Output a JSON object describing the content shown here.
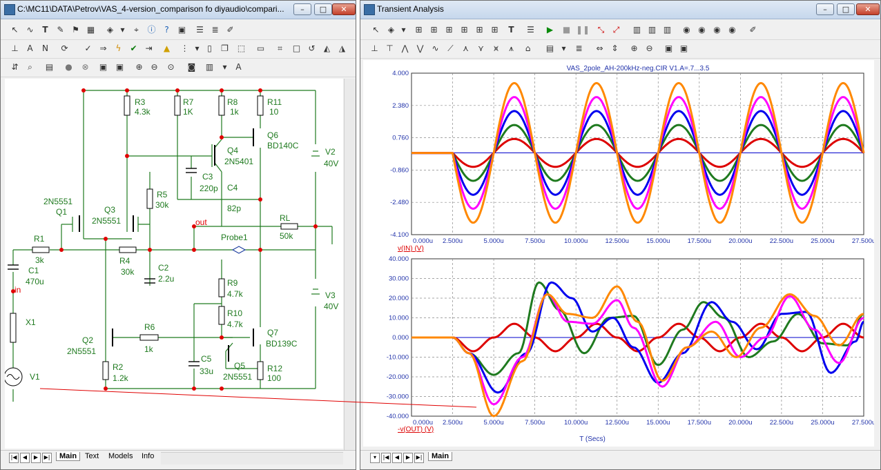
{
  "schematic_window": {
    "title": "C:\\MC11\\DATA\\Petrov\\VAS_4-version_comparison fo diyaudio\\compari...",
    "tabs": [
      "Main",
      "Text",
      "Models",
      "Info"
    ],
    "components": {
      "R3": {
        "name": "R3",
        "value": "4.3k"
      },
      "R7": {
        "name": "R7",
        "value": "1K"
      },
      "R8": {
        "name": "R8",
        "value": "1k"
      },
      "R11": {
        "name": "R11",
        "value": "10"
      },
      "Q6": {
        "name": "Q6",
        "value": "BD140C"
      },
      "Q4": {
        "name": "Q4",
        "value": "2N5401"
      },
      "C3": {
        "name": "C3",
        "value": "220p"
      },
      "C4": {
        "name": "C4",
        "value": "82p"
      },
      "V2": {
        "name": "V2",
        "value": "40V"
      },
      "V3": {
        "name": "V3",
        "value": "40V"
      },
      "R5": {
        "name": "R5",
        "value": "30k"
      },
      "Q1": {
        "name": "Q1",
        "value": "2N5551"
      },
      "Q3": {
        "name": "Q3",
        "value": "2N5551"
      },
      "RL": {
        "name": "RL",
        "value": "50k"
      },
      "R1": {
        "name": "R1",
        "value": "3k"
      },
      "R4": {
        "name": "R4",
        "value": "30k"
      },
      "C2": {
        "name": "C2",
        "value": "2.2u"
      },
      "C1": {
        "name": "C1",
        "value": "470u"
      },
      "R9": {
        "name": "R9",
        "value": "4.7k"
      },
      "R10": {
        "name": "R10",
        "value": "4.7k"
      },
      "X1": {
        "name": "X1",
        "value": ""
      },
      "Q2": {
        "name": "Q2",
        "value": "2N5551"
      },
      "R6": {
        "name": "R6",
        "value": "1k"
      },
      "Q7": {
        "name": "Q7",
        "value": "BD139C"
      },
      "C5": {
        "name": "C5",
        "value": "33u"
      },
      "Q5": {
        "name": "Q5",
        "value": "2N5551"
      },
      "R12": {
        "name": "R12",
        "value": "100"
      },
      "R2": {
        "name": "R2",
        "value": "1.2k"
      },
      "V1": {
        "name": "V1",
        "value": ""
      }
    },
    "node_labels": {
      "out": "out",
      "in": "in",
      "probe": "Probe1"
    }
  },
  "analysis_window": {
    "title": "Transient Analysis",
    "tabs": [
      "Main"
    ]
  },
  "chart_data": [
    {
      "type": "line",
      "title": "VAS_2pole_AH-200kHz-neg.CIR V1.A=.7...3.5",
      "xlabel": "",
      "ylabel": "v(IN) (V)",
      "xlim": [
        0,
        27.5
      ],
      "ylim": [
        -4.1,
        4.0
      ],
      "y_ticks": [
        "4.000",
        "2.380",
        "0.760",
        "-0.860",
        "-2.480",
        "-4.100"
      ],
      "x_ticks": [
        "0.000u",
        "2.500u",
        "5.000u",
        "7.500u",
        "10.000u",
        "12.500u",
        "15.000u",
        "17.500u",
        "20.000u",
        "22.500u",
        "25.000u",
        "27.500u"
      ],
      "x_unit": "us",
      "start_time_us": 2.5,
      "period_us": 5.0,
      "grid": true,
      "series": [
        {
          "color": "#dd0000",
          "amplitude": 0.7
        },
        {
          "color": "#1f7a1f",
          "amplitude": 1.4
        },
        {
          "color": "#0000ee",
          "amplitude": 2.1
        },
        {
          "color": "#ff00ff",
          "amplitude": 2.8
        },
        {
          "color": "#ff8800",
          "amplitude": 3.5
        }
      ],
      "baseline_color": "#0000cc"
    },
    {
      "type": "line",
      "title": "",
      "xlabel": "T (Secs)",
      "ylabel": "-v(OUT) (V)",
      "xlim": [
        0,
        27.5
      ],
      "ylim": [
        -40,
        40
      ],
      "y_ticks": [
        "40.000",
        "30.000",
        "20.000",
        "10.000",
        "0.000",
        "-10.000",
        "-20.000",
        "-30.000",
        "-40.000"
      ],
      "x_ticks": [
        "0.000u",
        "2.500u",
        "5.000u",
        "7.500u",
        "10.000u",
        "12.500u",
        "15.000u",
        "17.500u",
        "20.000u",
        "22.500u",
        "25.000u",
        "27.500u"
      ],
      "x_unit": "us",
      "grid": true,
      "series": [
        {
          "color": "#dd0000",
          "x": [
            0,
            2.5,
            3.75,
            5,
            6.25,
            7.5,
            8.75,
            10,
            11.25,
            12.5,
            13.75,
            15,
            16.25,
            17.5,
            18.75,
            20,
            21.25,
            22.5,
            23.75,
            25,
            26.25,
            27.5
          ],
          "y": [
            0,
            0,
            -7,
            0,
            7,
            0,
            -7,
            0,
            7,
            0,
            -7,
            0,
            7,
            0,
            -7,
            0,
            7,
            0,
            -7,
            0,
            7,
            0
          ]
        },
        {
          "color": "#1f7a1f",
          "x": [
            0,
            2.5,
            3.5,
            5,
            6.5,
            7.75,
            9,
            10.5,
            12,
            13.5,
            15,
            16.5,
            17.75,
            19,
            20.5,
            22,
            23.5,
            25,
            26.5,
            27.5
          ],
          "y": [
            0,
            0,
            -8,
            -19,
            -8,
            28,
            14,
            -8,
            10,
            11,
            -14,
            4,
            18,
            10,
            -10,
            -2,
            12,
            -3,
            -4,
            12
          ]
        },
        {
          "color": "#0000ee",
          "x": [
            0,
            2.5,
            3.5,
            5.25,
            7,
            8.5,
            9.75,
            11,
            12.25,
            13.5,
            15,
            16.5,
            18.25,
            19.5,
            21,
            22.5,
            24,
            25.5,
            27,
            27.5
          ],
          "y": [
            0,
            0,
            -8,
            -28,
            -8,
            28,
            20,
            3,
            10,
            -5,
            -23,
            -8,
            18,
            8,
            -6,
            12,
            13,
            -18,
            -2,
            8
          ]
        },
        {
          "color": "#ff00ff",
          "x": [
            0,
            2.5,
            3.5,
            5,
            6.75,
            8.25,
            9.5,
            11,
            12.5,
            13.5,
            15.25,
            16.75,
            18.5,
            20,
            21.5,
            23,
            24.5,
            26,
            27.5
          ],
          "y": [
            0,
            0,
            -8,
            -34,
            -10,
            22,
            8,
            7,
            19,
            5,
            -25,
            -5,
            8,
            -10,
            0,
            21,
            4,
            -13,
            10
          ]
        },
        {
          "color": "#ff8800",
          "x": [
            0,
            2.5,
            3.5,
            5,
            6.75,
            8.25,
            9.5,
            11,
            12.5,
            13.75,
            15.25,
            16.75,
            18.25,
            19.75,
            21.25,
            23,
            24.5,
            26,
            27.5
          ],
          "y": [
            0,
            0,
            -8,
            -40,
            -12,
            22,
            12,
            10,
            26,
            8,
            -22,
            -5,
            3,
            -10,
            5,
            22,
            11,
            -4,
            12
          ]
        }
      ],
      "baseline_color": "#0000cc"
    }
  ]
}
